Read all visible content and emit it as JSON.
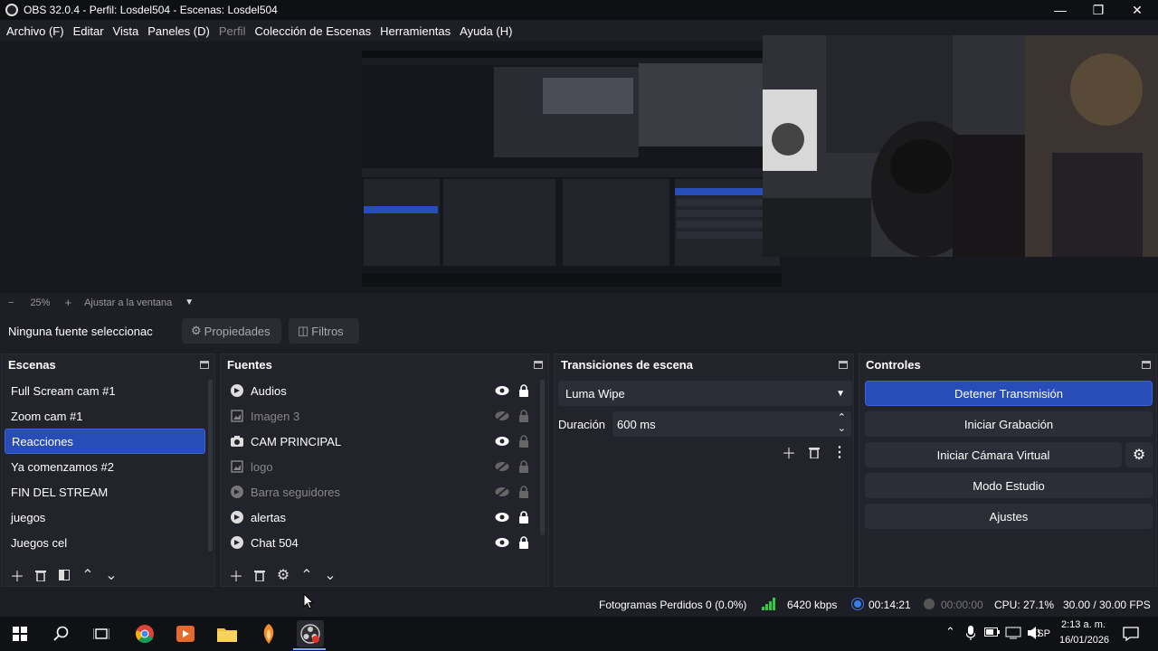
{
  "window": {
    "title": "OBS 32.0.4 - Perfil: Losdel504 - Escenas: Losdel504"
  },
  "menu": [
    {
      "label": "Archivo (F)",
      "disabled": false
    },
    {
      "label": "Editar",
      "disabled": false
    },
    {
      "label": "Vista",
      "disabled": false
    },
    {
      "label": "Paneles (D)",
      "disabled": false
    },
    {
      "label": "Perfil",
      "disabled": true
    },
    {
      "label": "Colección de Escenas",
      "disabled": false
    },
    {
      "label": "Herramientas",
      "disabled": false
    },
    {
      "label": "Ayuda (H)",
      "disabled": false
    }
  ],
  "zoom": {
    "minus": "−",
    "value": "25%",
    "plus": "+",
    "fit_label": "Ajustar a la ventana"
  },
  "source_bar": {
    "no_selection": "Ninguna fuente seleccionac",
    "properties": "Propiedades",
    "filters": "Filtros"
  },
  "scenes": {
    "title": "Escenas",
    "items": [
      "Full Scream cam #1",
      "Zoom cam #1",
      "Reacciones",
      "Ya comenzamos #2",
      "FIN DEL STREAM",
      "juegos",
      "Juegos cel"
    ],
    "selected": "Reacciones"
  },
  "sources": {
    "title": "Fuentes",
    "items": [
      {
        "label": "Audios",
        "icon": "browser-icon",
        "visible": true,
        "locked": true
      },
      {
        "label": "Imagen 3",
        "icon": "image-icon",
        "visible": false,
        "locked": false
      },
      {
        "label": "CAM PRINCIPAL",
        "icon": "camera-icon",
        "visible": true,
        "locked": false
      },
      {
        "label": "logo",
        "icon": "image-icon",
        "visible": false,
        "locked": false
      },
      {
        "label": "Barra seguidores",
        "icon": "browser-icon",
        "visible": false,
        "locked": false
      },
      {
        "label": "alertas",
        "icon": "browser-icon",
        "visible": true,
        "locked": true
      },
      {
        "label": "Chat 504",
        "icon": "browser-icon",
        "visible": true,
        "locked": true
      }
    ]
  },
  "transitions": {
    "title": "Transiciones de escena",
    "selected": "Luma Wipe",
    "duration_label": "Duración",
    "duration_value": "600 ms"
  },
  "controls": {
    "title": "Controles",
    "buttons": [
      "Detener Transmisión",
      "Iniciar Grabación",
      "Iniciar Cámara Virtual",
      "Modo Estudio",
      "Ajustes"
    ]
  },
  "status": {
    "dropped": "Fotogramas Perdidos 0 (0.0%)",
    "bitrate": "6420 kbps",
    "stream_time": "00:14:21",
    "rec_time": "00:00:00",
    "cpu": "CPU: 27.1%",
    "fps": "30.00 / 30.00 FPS"
  },
  "taskbar": {
    "lang": "ESP",
    "time": "2:13 a. m.",
    "date": "16/01/2026"
  },
  "colors": {
    "accent": "#284cb8",
    "bg": "#1e1f26",
    "dock": "#22232b",
    "green": "#2ecc40"
  }
}
